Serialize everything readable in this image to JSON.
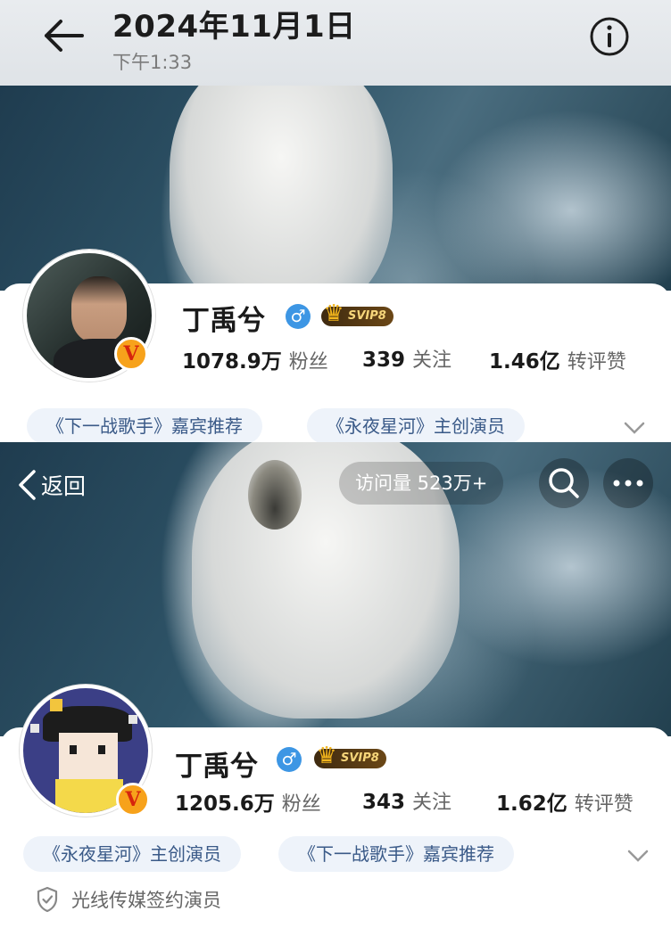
{
  "viewer": {
    "date": "2024年11月1日",
    "time": "下午1:33",
    "back_icon": "arrow-left-icon",
    "info_icon": "info-circle-icon"
  },
  "profile_old": {
    "name": "丁禹兮",
    "gender_icon": "male-icon",
    "vip_label": "SVIP8",
    "fans_num": "1078.9万",
    "fans_label": "粉丝",
    "follow_num": "339",
    "follow_label": "关注",
    "likes_num": "1.46亿",
    "likes_label": "转评赞",
    "tags": [
      "《下一战歌手》嘉宾推荐",
      "《永夜星河》主创演员"
    ],
    "verified_badge": "V"
  },
  "profile_new": {
    "nav": {
      "back_label": "返回",
      "visits": "访问量 523万+",
      "search_icon": "search-icon",
      "more_icon": "more-dots-icon"
    },
    "name": "丁禹兮",
    "gender_icon": "male-icon",
    "vip_label": "SVIP8",
    "fans_num": "1205.6万",
    "fans_label": "粉丝",
    "follow_num": "343",
    "follow_label": "关注",
    "likes_num": "1.62亿",
    "likes_label": "转评赞",
    "tags": [
      "《永夜星河》主创演员",
      "《下一战歌手》嘉宾推荐"
    ],
    "verified_badge": "V",
    "certification": "光线传媒签约演员"
  },
  "colors": {
    "accent_blue": "#3d96e4",
    "tag_bg": "#eef3fa",
    "tag_text": "#3a5a88",
    "badge_orange": "#f7a21b"
  }
}
